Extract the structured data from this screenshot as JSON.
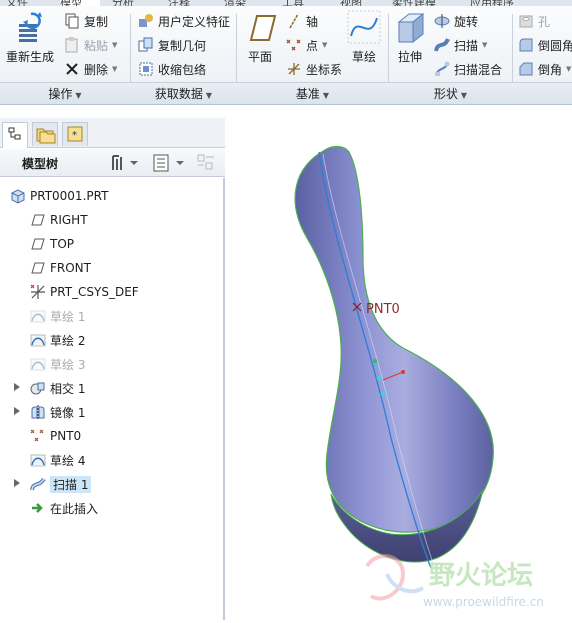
{
  "ribbon": {
    "tabs": [
      "文件",
      "模型",
      "分析",
      "注释",
      "渲染",
      "工具",
      "视图",
      "柔性建模",
      "应用程序"
    ],
    "operations": {
      "regenerate": "重新生成",
      "copy": "复制",
      "paste": "粘贴",
      "delete": "删除",
      "group_label": "操作"
    },
    "get_data": {
      "udf": "用户定义特征",
      "copy_geometry": "复制几何",
      "shrinkwrap": "收缩包络",
      "group_label": "获取数据"
    },
    "datum": {
      "plane": "平面",
      "axis": "轴",
      "point": "点",
      "csys": "坐标系",
      "sketch": "草绘",
      "group_label": "基准"
    },
    "shapes": {
      "extrude": "拉伸",
      "revolve": "旋转",
      "sweep": "扫描",
      "swept_blend": "扫描混合",
      "group_label": "形状"
    },
    "engineering": {
      "hole": "孔",
      "round": "倒圆角",
      "chamfer": "倒角"
    }
  },
  "left_panel": {
    "header_title": "模型树",
    "tree": [
      {
        "label": "PRT0001.PRT",
        "icon": "part-icon",
        "state": "normal",
        "expandable": false
      },
      {
        "label": "RIGHT",
        "icon": "datum-plane-icon",
        "state": "normal",
        "expandable": false
      },
      {
        "label": "TOP",
        "icon": "datum-plane-icon",
        "state": "normal",
        "expandable": false
      },
      {
        "label": "FRONT",
        "icon": "datum-plane-icon",
        "state": "normal",
        "expandable": false
      },
      {
        "label": "PRT_CSYS_DEF",
        "icon": "csys-icon",
        "state": "normal",
        "expandable": false
      },
      {
        "label": "草绘 1",
        "icon": "sketch-icon",
        "state": "suppressed",
        "expandable": false
      },
      {
        "label": "草绘 2",
        "icon": "sketch-icon",
        "state": "normal",
        "expandable": false
      },
      {
        "label": "草绘 3",
        "icon": "sketch-icon",
        "state": "suppressed",
        "expandable": false
      },
      {
        "label": "相交 1",
        "icon": "intersect-icon",
        "state": "normal",
        "expandable": true
      },
      {
        "label": "镜像 1",
        "icon": "mirror-icon",
        "state": "normal",
        "expandable": true
      },
      {
        "label": "PNT0",
        "icon": "datum-point-icon",
        "state": "normal",
        "expandable": false
      },
      {
        "label": "草绘 4",
        "icon": "sketch-icon",
        "state": "normal",
        "expandable": false
      },
      {
        "label": "扫描 1",
        "icon": "sweep-icon",
        "state": "selected",
        "expandable": true
      },
      {
        "label": "在此插入",
        "icon": "insert-here-icon",
        "state": "normal",
        "expandable": false
      }
    ]
  },
  "viewport": {
    "point_label": "PNT0",
    "watermark_cn": "野火论坛",
    "watermark_url": "www.proewildfire.cn",
    "colors": {
      "body": "#7b80c2",
      "edge": "#4caf50",
      "axis": "#2a7fd6"
    }
  }
}
